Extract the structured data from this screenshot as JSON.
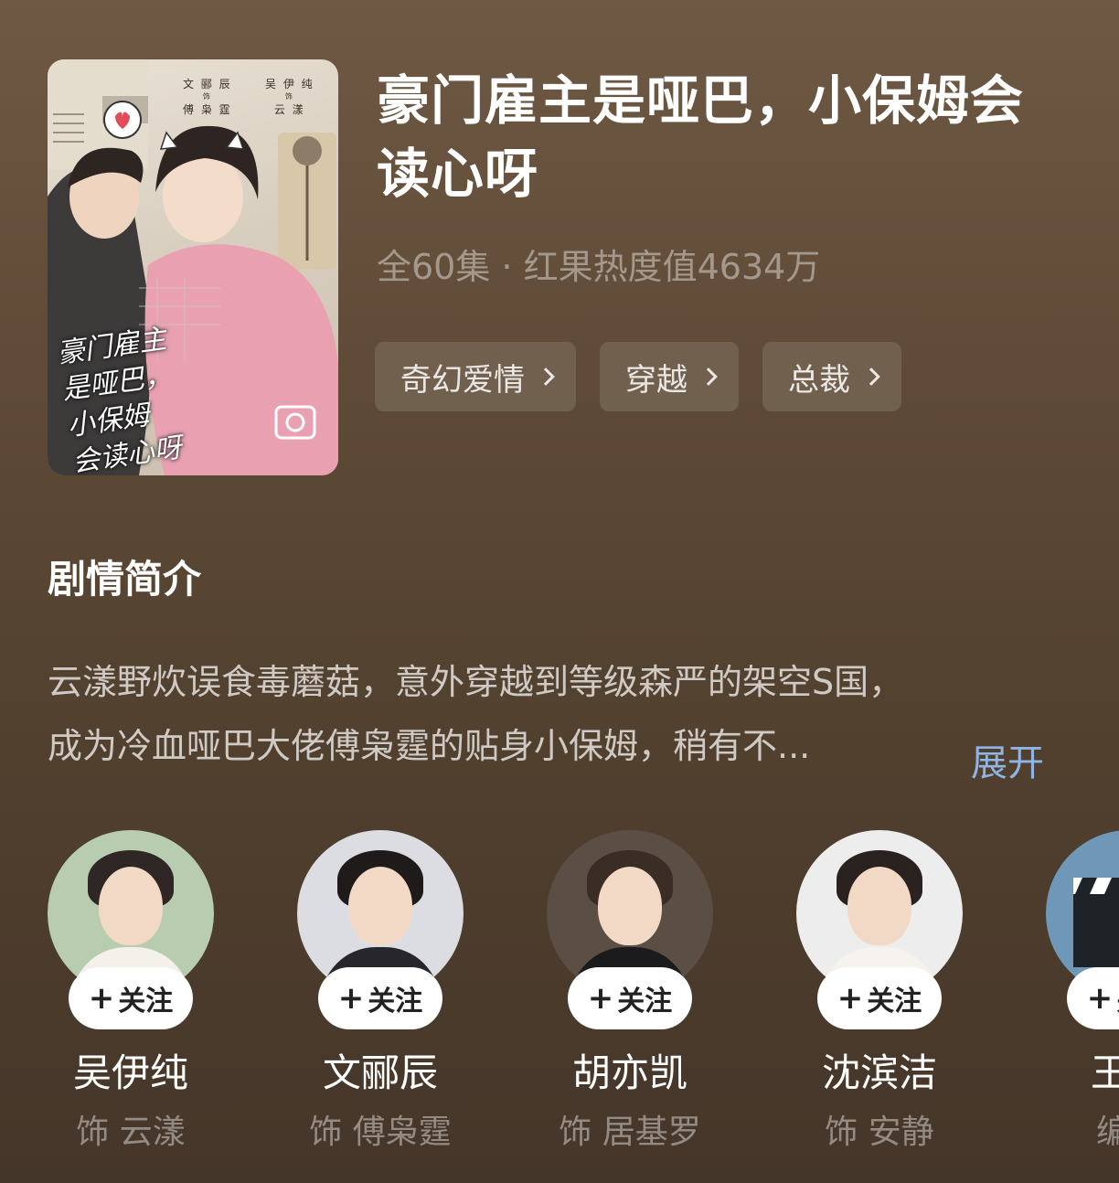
{
  "poster": {
    "credit_left_actor": "文 郦 辰",
    "credit_left_role_prefix": "饰",
    "credit_left_role": "傅 枭 霆",
    "credit_right_actor": "吴 伊 纯",
    "credit_right_role_prefix": "饰",
    "credit_right_role": "云 漾",
    "scribble_line1": "豪门雇主",
    "scribble_line2": "是哑巴，",
    "scribble_line3": "小保姆",
    "scribble_line4": "会读心呀"
  },
  "show": {
    "title": "豪门雇主是哑巴，小保姆会读心呀",
    "meta": "全60集 · 红果热度值4634万"
  },
  "tags": [
    {
      "label": "奇幻爱情"
    },
    {
      "label": "穿越"
    },
    {
      "label": "总裁"
    }
  ],
  "synopsis": {
    "heading": "剧情简介",
    "line1": "云漾野炊误食毒蘑菇，意外穿越到等级森严的架空S国，",
    "line2": "成为冷血哑巴大佬傅枭霆的贴身小保姆，稍有不...",
    "expand_label": "展开",
    "expand_color": "#8fb5e6"
  },
  "cast": [
    {
      "name": "吴伊纯",
      "role": "饰 云漾",
      "follow_label": "关注"
    },
    {
      "name": "文郦辰",
      "role": "饰 傅枭霆",
      "follow_label": "关注"
    },
    {
      "name": "胡亦凯",
      "role": "饰 居基罗",
      "follow_label": "关注"
    },
    {
      "name": "沈滨洁",
      "role": "饰 安静",
      "follow_label": "关注"
    },
    {
      "name": "王洌",
      "role": "编剧",
      "follow_label": "关注"
    }
  ]
}
